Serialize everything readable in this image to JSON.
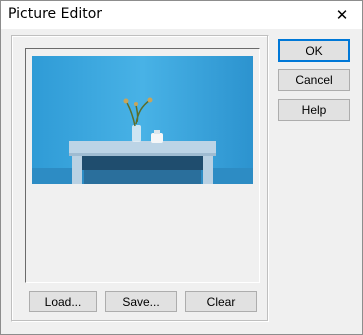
{
  "window": {
    "title": "Picture Editor",
    "close_glyph": "✕"
  },
  "buttons": {
    "ok": "OK",
    "cancel": "Cancel",
    "help": "Help",
    "load": "Load...",
    "save": "Save...",
    "clear": "Clear"
  },
  "colors": {
    "accent": "#0078d7",
    "photo_wall": "#3aa6de",
    "table_top": "#bcd4e6"
  },
  "icons": {
    "close": "close-icon"
  }
}
